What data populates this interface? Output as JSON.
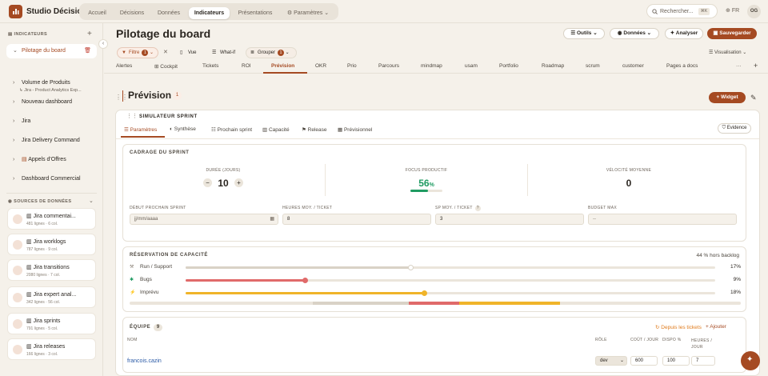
{
  "app": {
    "brand": "Studio Décision"
  },
  "nav": {
    "tabs": [
      "Accueil",
      "Décisions",
      "Données",
      "Indicateurs",
      "Présentations",
      "Paramètres"
    ],
    "active": "Indicateurs"
  },
  "search": {
    "placeholder": "Rechercher...",
    "shortcut": "⌘K"
  },
  "lang": "FR",
  "user": {
    "initials": "OG"
  },
  "sidebar": {
    "indicators_title": "INDICATEURS",
    "items": [
      "Pilotage du board",
      "Volume de Produits",
      "Nouveau dashboard",
      "Jira",
      "Jira Delivery Command",
      "Appels d'Offres",
      "Dashboard Commercial"
    ],
    "subitem": "Jira - Product Analytics Exp...",
    "sources_title": "SOURCES DE DONNÉES",
    "sources": [
      {
        "name": "Jira commentai...",
        "meta": "481 lignes · 6 col."
      },
      {
        "name": "Jira worklogs",
        "meta": "787 lignes · 9 col."
      },
      {
        "name": "Jira transitions",
        "meta": "2080 lignes · 7 col."
      },
      {
        "name": "Jira expert anal...",
        "meta": "342 lignes · 56 col."
      },
      {
        "name": "Jira sprints",
        "meta": "791 lignes · 5 col."
      },
      {
        "name": "Jira releases",
        "meta": "166 lignes · 3 col."
      }
    ]
  },
  "header": {
    "title": "Pilotage du board",
    "tools": "Outils",
    "data": "Données",
    "analyze": "Analyser",
    "save": "Sauvegarder"
  },
  "filters": {
    "filter": "Filtre",
    "filter_count": "1",
    "view": "Vue",
    "whatif": "What-if",
    "group": "Grouper",
    "group_count": "1",
    "display": "Visualisation"
  },
  "tabs": [
    "Alertes",
    "Cockpit",
    "Tickets",
    "ROI",
    "Prévision",
    "OKR",
    "Prio",
    "Parcours",
    "mindmap",
    "usam",
    "Portfolio",
    "Roadmap",
    "scrum",
    "customer",
    "Pages a docs"
  ],
  "section": {
    "title": "Prévision",
    "count": "1",
    "widget": "Widget"
  },
  "widget": {
    "title": "SIMULATEUR SPRINT",
    "subtabs": [
      "Paramètres",
      "Synthèse",
      "Prochain sprint",
      "Capacité",
      "Release",
      "Prévisionnel"
    ],
    "evidence": "Evidence"
  },
  "cadrage": {
    "title": "CADRAGE DU SPRINT",
    "duration_label": "DURÉE (JOURS)",
    "duration_value": "10",
    "focus_label": "FOCUS PRODUCTIF",
    "focus_value": "56",
    "focus_unit": "%",
    "focus_fraction": 0.56,
    "velocity_label": "VÉLOCITÉ MOYENNE",
    "velocity_value": "0",
    "fields": [
      {
        "label": "DÉBUT PROCHAIN SPRINT",
        "value": "jj/mm/aaaa"
      },
      {
        "label": "HEURES MOY. / TICKET",
        "value": "8"
      },
      {
        "label": "SP MOY. / TICKET",
        "value": "3"
      },
      {
        "label": "BUDGET MAX",
        "value": "--"
      }
    ]
  },
  "capacity": {
    "title": "RÉSERVATION DE CAPACITÉ",
    "summary": "44 % hors backlog",
    "rows": [
      {
        "label": "Run / Support",
        "pct": "17%",
        "value": 0.17,
        "color": "#d9d2c6"
      },
      {
        "label": "Bugs",
        "pct": "9%",
        "value": 0.09,
        "color": "#e06a6a"
      },
      {
        "label": "Imprévu",
        "pct": "18%",
        "value": 0.18,
        "color": "#f0b429"
      }
    ]
  },
  "team": {
    "title": "ÉQUIPE",
    "count": "9",
    "from_tickets": "Depuis les tickets",
    "add": "Ajouter",
    "cols": [
      "NOM",
      "RÔLE",
      "COÛT / JOUR",
      "DISPO %",
      "HEURES / JOUR"
    ],
    "row": {
      "name": "francois.cazin",
      "role": "dev",
      "cost": "600",
      "dispo": "100",
      "hours": "7"
    }
  }
}
